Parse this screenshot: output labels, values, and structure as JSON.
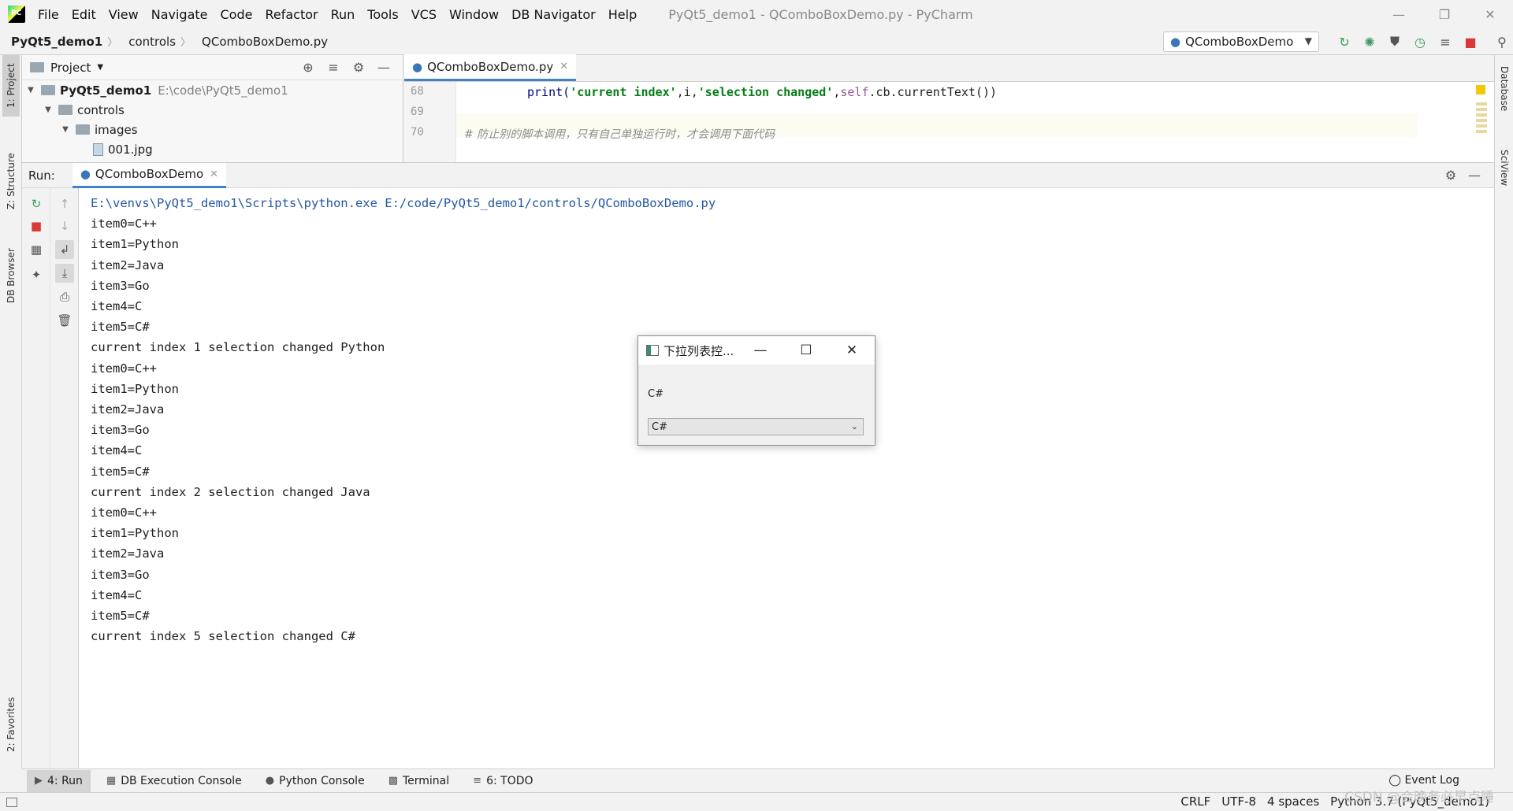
{
  "app": {
    "menu": [
      "File",
      "Edit",
      "View",
      "Navigate",
      "Code",
      "Refactor",
      "Run",
      "Tools",
      "VCS",
      "Window",
      "DB Navigator",
      "Help"
    ],
    "window_title": "PyQt5_demo1 - QComboBoxDemo.py - PyCharm"
  },
  "navbar": {
    "crumbs": [
      "PyQt5_demo1",
      "controls",
      "QComboBoxDemo.py"
    ],
    "run_config": "QComboBoxDemo"
  },
  "left_stripe": {
    "project": "1: Project",
    "structure": "Z: Structure",
    "db_browser": "DB Browser",
    "favorites": "2: Favorites"
  },
  "right_stripe": {
    "database": "Database",
    "sciview": "SciView"
  },
  "project_panel": {
    "title": "Project",
    "tree": [
      {
        "name": "PyQt5_demo1",
        "path": "E:\\code\\PyQt5_demo1"
      },
      {
        "name": "controls"
      },
      {
        "name": "images"
      },
      {
        "name": "001.jpg"
      }
    ]
  },
  "editor": {
    "tab": "QComboBoxDemo.py",
    "lines": [
      {
        "num": "68",
        "parts": [
          "print(",
          "'current index'",
          ",i,",
          "'selection changed'",
          ",",
          "self",
          ".cb.currentText())"
        ]
      },
      {
        "num": "69",
        "parts": []
      },
      {
        "num": "70",
        "comment": "# 防止别的脚本调用，只有自己单独运行时，才会调用下面代码"
      }
    ]
  },
  "run": {
    "label": "Run:",
    "tab": "QComboBoxDemo",
    "command": "E:\\venvs\\PyQt5_demo1\\Scripts\\python.exe E:/code/PyQt5_demo1/controls/QComboBoxDemo.py",
    "output": [
      "item0=C++",
      "item1=Python",
      "item2=Java",
      "item3=Go",
      "item4=C",
      "item5=C#",
      "current index 1 selection changed Python",
      "item0=C++",
      "item1=Python",
      "item2=Java",
      "item3=Go",
      "item4=C",
      "item5=C#",
      "current index 2 selection changed Java",
      "item0=C++",
      "item1=Python",
      "item2=Java",
      "item3=Go",
      "item4=C",
      "item5=C#",
      "current index 5 selection changed C#"
    ]
  },
  "dialog": {
    "title": "下拉列表控...",
    "label": "C#",
    "combo_value": "C#"
  },
  "bottom_tabs": {
    "run": "4: Run",
    "db_console": "DB Execution Console",
    "python_console": "Python Console",
    "terminal": "Terminal",
    "todo": "6: TODO",
    "event_log": "Event Log"
  },
  "status": {
    "line_sep": "CRLF",
    "encoding": "UTF-8",
    "indent": "4 spaces",
    "interpreter": "Python 3.7 (PyQt5_demo1)",
    "watermark": "CSDN @会晚务必早点睡"
  }
}
